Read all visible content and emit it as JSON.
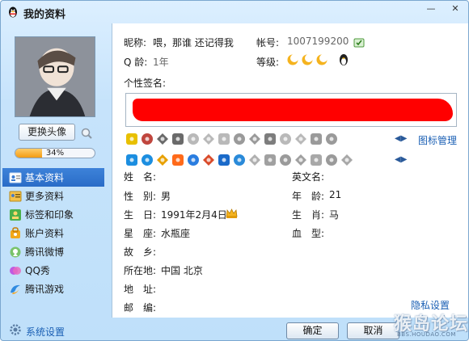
{
  "window": {
    "title": "我的资料",
    "minimize_glyph": "—",
    "close_glyph": "✕"
  },
  "left": {
    "change_avatar_label": "更换头像",
    "progress_percent": 34,
    "progress_label": "34%"
  },
  "sidebar": {
    "items": [
      {
        "label": "基本资料",
        "icon": "profile-card-icon",
        "active": true
      },
      {
        "label": "更多资料",
        "icon": "more-info-icon",
        "active": false
      },
      {
        "label": "标签和印象",
        "icon": "tag-icon",
        "active": false
      },
      {
        "label": "账户资料",
        "icon": "account-icon",
        "active": false
      },
      {
        "label": "腾讯微博",
        "icon": "weibo-icon",
        "active": false
      },
      {
        "label": "QQ秀",
        "icon": "qqshow-icon",
        "active": false
      },
      {
        "label": "腾讯游戏",
        "icon": "game-icon",
        "active": false
      }
    ]
  },
  "profile": {
    "nickname_label": "昵称:",
    "nickname_value": "喂，那谁 还记得我",
    "account_label": "帐号:",
    "account_value": "1007199200",
    "qage_label": "Q 龄:",
    "qage_value": "1年",
    "level_label": "等级:",
    "signature_label": "个性签名:",
    "icon_manage_label": "图标管理"
  },
  "details": {
    "name_label": "姓　名:",
    "name_value": "",
    "english_name_label": "英文名:",
    "english_name_value": "",
    "gender_label": "性　别:",
    "gender_value": "男",
    "age_label": "年　龄:",
    "age_value": "21",
    "birthday_label": "生　日:",
    "birthday_value": "1991年2月4日",
    "zodiac_label": "生　肖:",
    "zodiac_value": "马",
    "constellation_label": "星　座:",
    "constellation_value": "水瓶座",
    "blood_label": "血　型:",
    "blood_value": "",
    "hometown_label": "故　乡:",
    "hometown_value": "",
    "location_label": "所在地:",
    "location_value": "中国 北京",
    "address_label": "地　址:",
    "address_value": "",
    "postcode_label": "邮　编:",
    "postcode_value": "",
    "privacy_label": "隐私设置"
  },
  "footer": {
    "settings_label": "系统设置",
    "ok_label": "确定",
    "cancel_label": "取消"
  },
  "watermark": {
    "text": "猴岛论坛",
    "sub": "BBS.HOUDAO.COM"
  },
  "colors": {
    "accent": "#2a6cc7",
    "link": "#1a5fb4",
    "redaction": "#ff0000",
    "progress": "#f39c12"
  }
}
